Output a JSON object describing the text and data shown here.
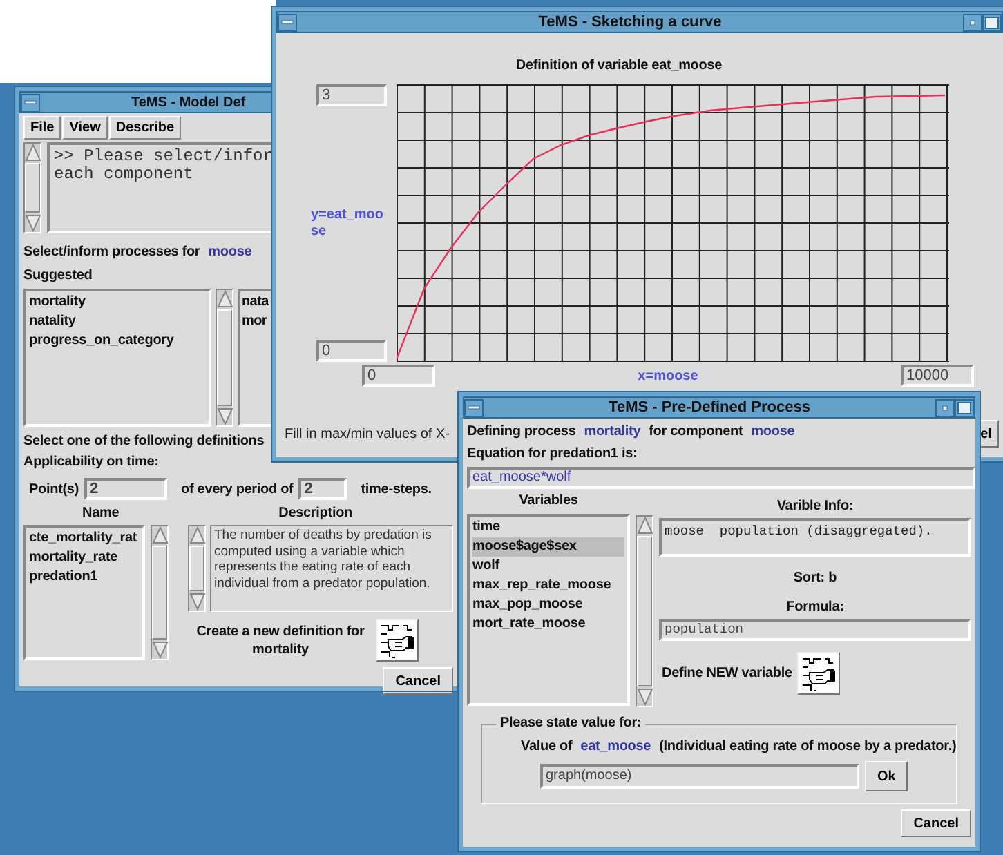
{
  "model_window": {
    "title": "TeMS - Model Def",
    "menu": [
      "File",
      "View",
      "Describe"
    ],
    "message_lines": [
      ">> Please select/infor",
      "each component"
    ],
    "process_prompt": {
      "label": "Select/inform processes for",
      "component": "moose"
    },
    "suggested_label": "Suggested",
    "suggested": [
      "mortality",
      "natality",
      "progress_on_category"
    ],
    "chosen": [
      "nata",
      "mor"
    ],
    "definitions_prompt": "Select one of the following definitions",
    "applicability_label": "Applicability on time:",
    "points_label": "Point(s)",
    "points_value": "2",
    "period_label": "of every period of",
    "period_value": "2",
    "steps_label": "time-steps.",
    "name_heading": "Name",
    "description_heading": "Description",
    "definitions": [
      "cte_mortality_rat",
      "mortality_rate",
      "predation1"
    ],
    "description": "The number of deaths by predation is computed using a variable which represents the eating rate of each individual from a predator population.",
    "create_label": "Create a new definition for mortality",
    "cancel": "Cancel"
  },
  "sketch_window": {
    "title": "TeMS - Sketching a curve",
    "heading": "Definition of variable eat_moose",
    "y_max": "3",
    "y_min": "0",
    "y_label": "y=eat_moose",
    "x_min": "0",
    "x_label": "x=moose",
    "x_max": "10000",
    "hint": "Fill in max/min values of X-",
    "button": "el"
  },
  "predefined_window": {
    "title": "TeMS - Pre-Defined Process",
    "process_line": {
      "prefix": "Defining process",
      "process": "mortality",
      "middle": "for component",
      "component": "moose"
    },
    "equation_label": "Equation for predation1 is:",
    "equation": "eat_moose*wolf",
    "variables_heading": "Variables",
    "variables": [
      {
        "name": "time",
        "selected": false
      },
      {
        "name": "moose$age$sex",
        "selected": true
      },
      {
        "name": "wolf",
        "selected": false
      },
      {
        "name": "max_rep_rate_moose",
        "selected": false
      },
      {
        "name": "max_pop_moose",
        "selected": false
      },
      {
        "name": "mort_rate_moose",
        "selected": false
      }
    ],
    "info_heading": "Varible Info:",
    "info": "moose  population (disaggregated).",
    "sort": "Sort: b",
    "formula_label": "Formula:",
    "formula": "population",
    "define_label": "Define NEW variable",
    "group_label": "Please state value for:",
    "value_prefix": "Value of",
    "value_variable": "eat_moose",
    "value_description": "(Individual eating rate of moose by a predator.)",
    "value": "graph(moose)",
    "ok": "Ok",
    "cancel": "Cancel"
  }
}
